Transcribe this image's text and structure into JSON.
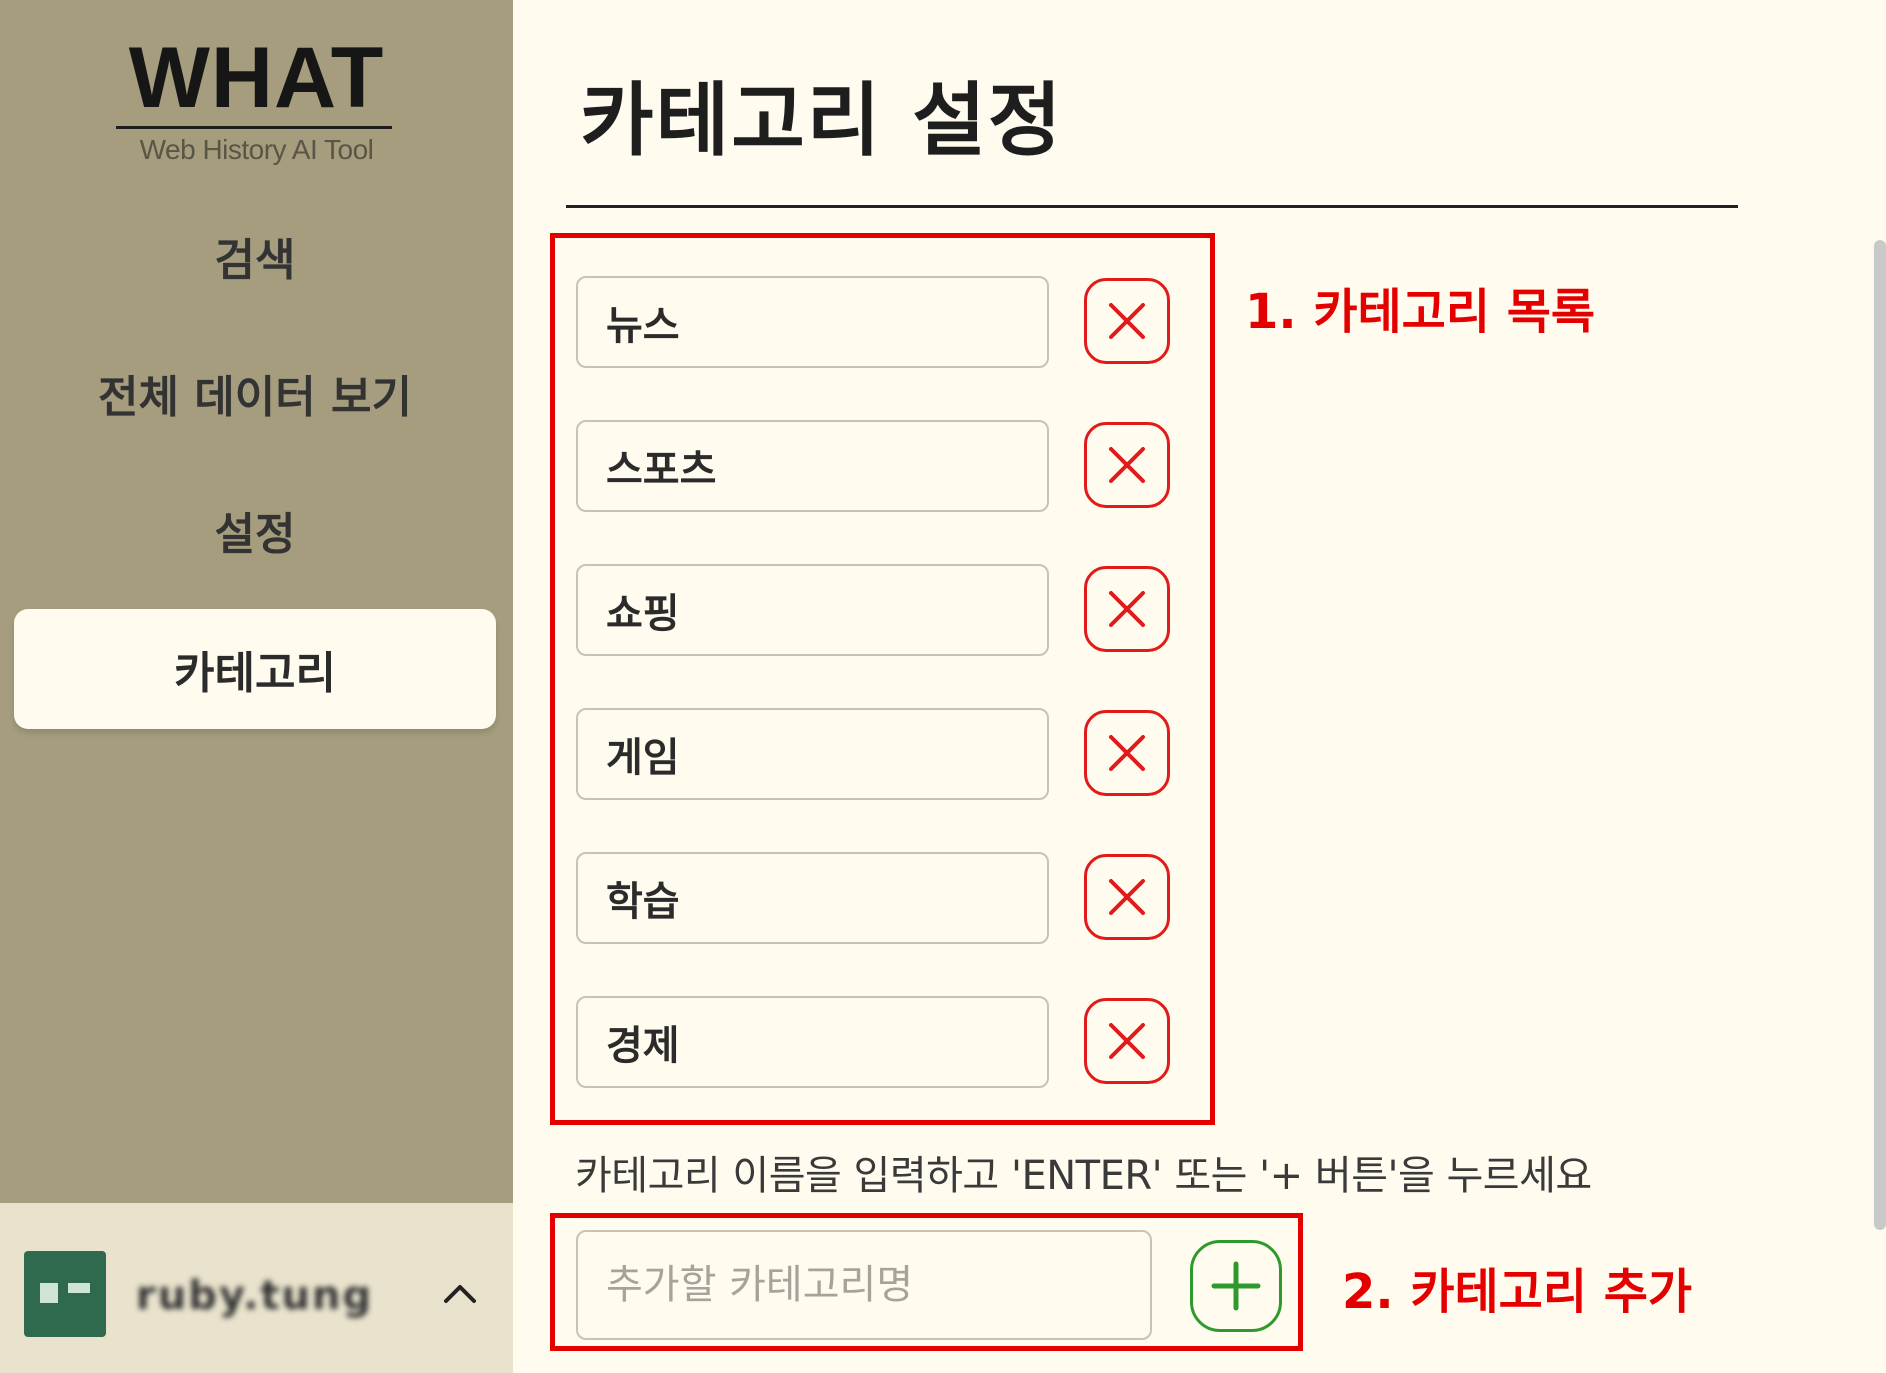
{
  "app": {
    "logo_title": "WHAT",
    "logo_subtitle": "Web History AI Tool"
  },
  "sidebar": {
    "items": [
      {
        "label": "검색",
        "active": false
      },
      {
        "label": "전체 데이터 보기",
        "active": false
      },
      {
        "label": "설정",
        "active": false
      },
      {
        "label": "카테고리",
        "active": true
      }
    ],
    "user": {
      "name": "ruby.tung",
      "icon": "chevron-up-icon"
    }
  },
  "main": {
    "title": "카테고리 설정",
    "categories": [
      {
        "name": "뉴스",
        "delete_icon": "close-icon"
      },
      {
        "name": "스포츠",
        "delete_icon": "close-icon"
      },
      {
        "name": "쇼핑",
        "delete_icon": "close-icon"
      },
      {
        "name": "게임",
        "delete_icon": "close-icon"
      },
      {
        "name": "학습",
        "delete_icon": "close-icon"
      },
      {
        "name": "경제",
        "delete_icon": "close-icon"
      }
    ],
    "hint": "카테고리 이름을 입력하고 'ENTER' 또는 '+ 버튼'을 누르세요",
    "add_input": {
      "value": "",
      "placeholder": "추가할 카테고리명"
    },
    "add_icon": "plus-icon"
  },
  "annotations": {
    "list_label": "1. 카테고리 목록",
    "add_label": "2. 카테고리 추가"
  },
  "colors": {
    "sidebar_bg": "#a59d7e",
    "page_bg": "#fffbee",
    "annotation_red": "#e50000",
    "delete_red": "#e11a1a",
    "add_green": "#2e9a2e"
  }
}
